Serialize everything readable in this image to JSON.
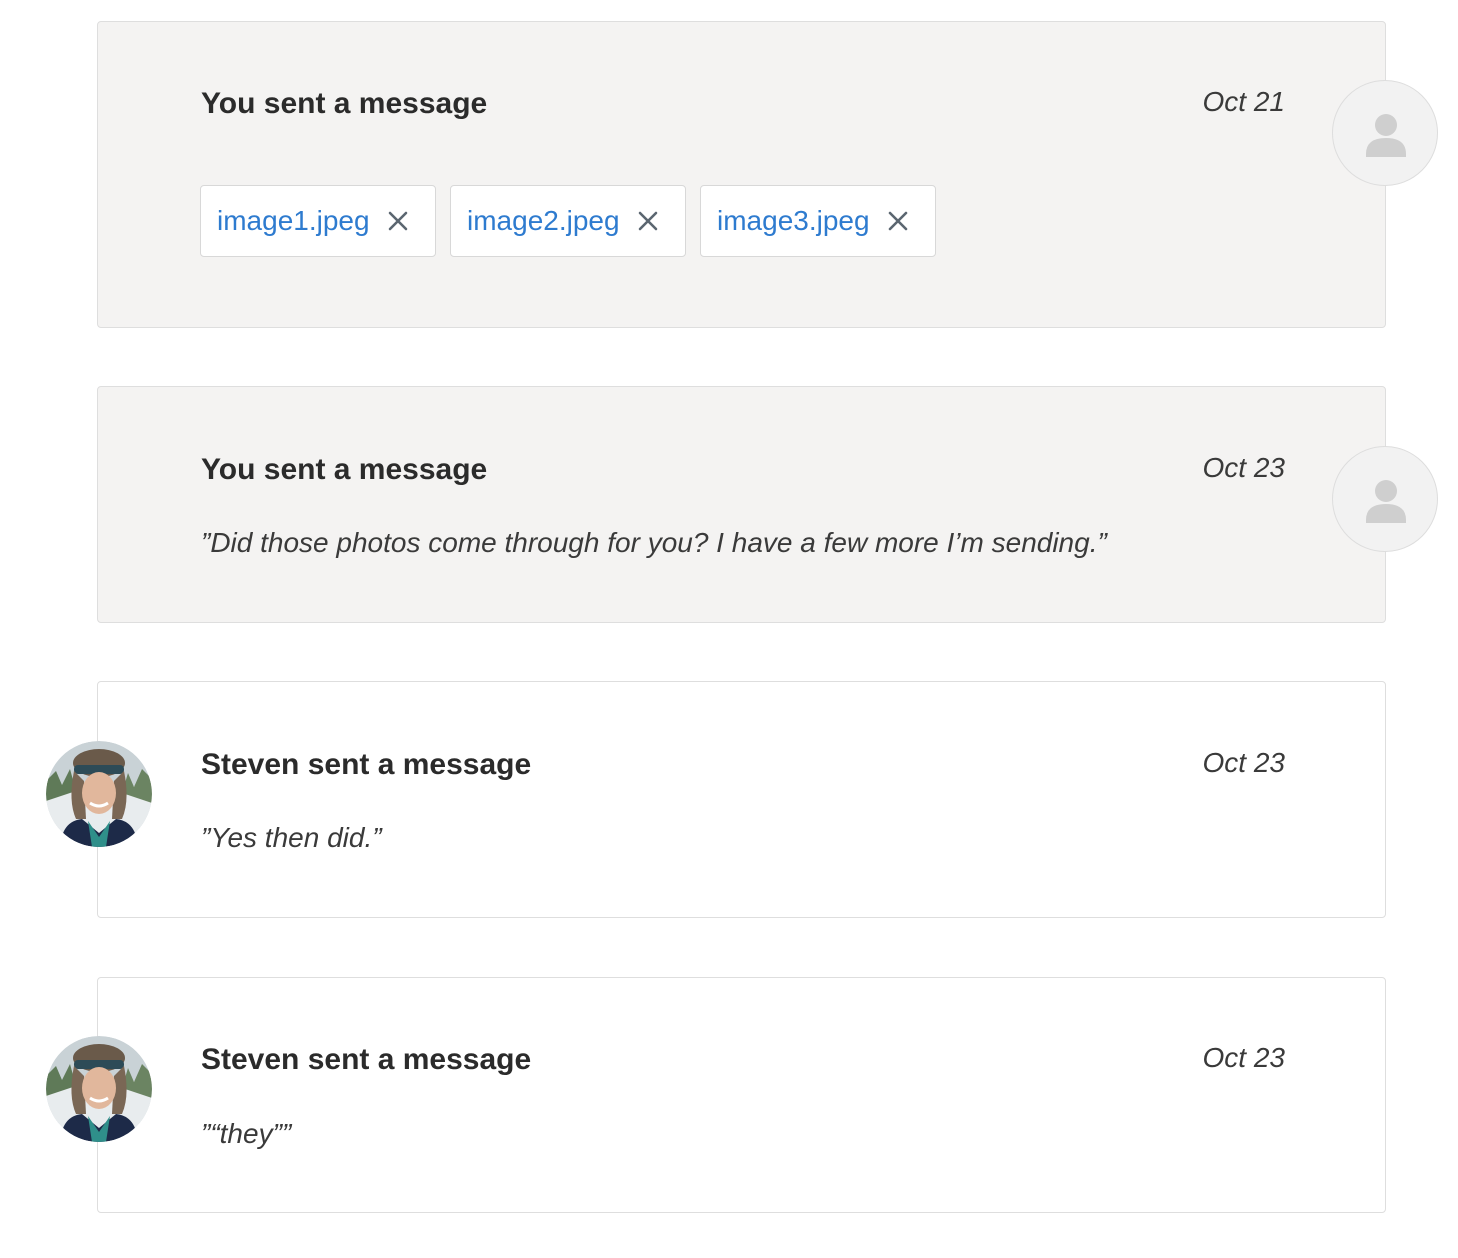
{
  "messages": [
    {
      "title": "You sent a message",
      "date": "Oct 21",
      "attachments": [
        {
          "name": "image1.jpeg"
        },
        {
          "name": "image2.jpeg"
        },
        {
          "name": "image3.jpeg"
        }
      ]
    },
    {
      "title": "You sent a message",
      "date": "Oct 23",
      "text": "”Did those photos come through for you? I have a few more I’m sending.”"
    },
    {
      "title": "Steven sent a message",
      "date": "Oct 23",
      "text": "”Yes then did.”"
    },
    {
      "title": "Steven sent a message",
      "date": "Oct 23",
      "text": "”“they””"
    }
  ],
  "icons": {
    "placeholder_avatar": "user-silhouette-icon",
    "attachment_remove": "close-icon",
    "contact_avatar": "steven-avatar"
  },
  "colors": {
    "sent_card_bg": "#f4f3f2",
    "received_card_bg": "#ffffff",
    "link": "#2e7bcf",
    "text": "#2b2b2b"
  }
}
